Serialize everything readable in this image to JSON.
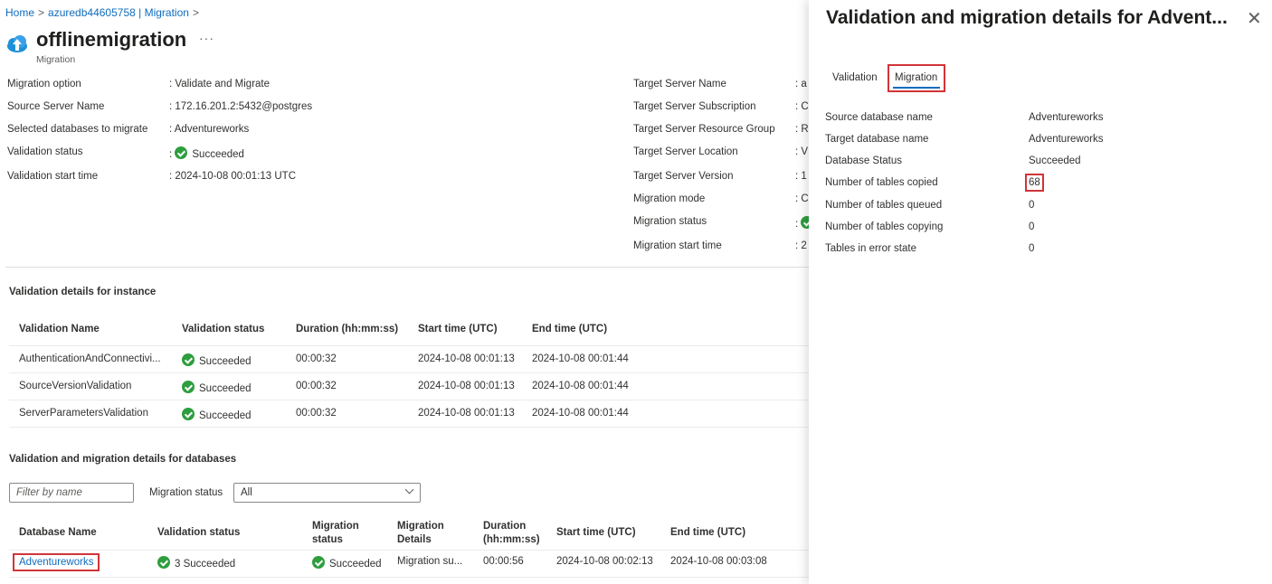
{
  "breadcrumb": {
    "home": "Home",
    "server": "azuredb44605758 | Migration",
    "sep": ">"
  },
  "header": {
    "title": "offlinemigration",
    "more": "···",
    "subtitle": "Migration"
  },
  "summary_left": [
    {
      "label": "Migration option",
      "value": ": Validate and Migrate"
    },
    {
      "label": "Source Server Name",
      "value": ": 172.16.201.2:5432@postgres"
    },
    {
      "label": "Selected databases to migrate",
      "value": ": Adventureworks"
    },
    {
      "label": "Validation status",
      "value": "Succeeded"
    },
    {
      "label": "Validation start time",
      "value": ": 2024-10-08 00:01:13 UTC"
    }
  ],
  "summary_right": [
    {
      "label": "Target Server Name",
      "value": ": a"
    },
    {
      "label": "Target Server Subscription",
      "value": ": C"
    },
    {
      "label": "Target Server Resource Group",
      "value": ": R"
    },
    {
      "label": "Target Server Location",
      "value": ": V"
    },
    {
      "label": "Target Server Version",
      "value": ": 1"
    },
    {
      "label": "Migration mode",
      "value": ": C"
    },
    {
      "label": "Migration status",
      "value": ":"
    },
    {
      "label": "Migration start time",
      "value": ": 2"
    }
  ],
  "instance_validation": {
    "title": "Validation details for instance",
    "headers": [
      "Validation Name",
      "Validation status",
      "Duration (hh:mm:ss)",
      "Start time (UTC)",
      "End time (UTC)"
    ],
    "rows": [
      [
        "AuthenticationAndConnectivi...",
        "Succeeded",
        "00:00:32",
        "2024-10-08 00:01:13",
        "2024-10-08 00:01:44"
      ],
      [
        "SourceVersionValidation",
        "Succeeded",
        "00:00:32",
        "2024-10-08 00:01:13",
        "2024-10-08 00:01:44"
      ],
      [
        "ServerParametersValidation",
        "Succeeded",
        "00:00:32",
        "2024-10-08 00:01:13",
        "2024-10-08 00:01:44"
      ]
    ]
  },
  "databases": {
    "title": "Validation and migration details for databases",
    "filter_placeholder": "Filter by name",
    "status_label": "Migration status",
    "status_value": "All",
    "headers": {
      "db_name": "Database Name",
      "validation_status": "Validation status",
      "migration_status_1": "Migration",
      "migration_status_2": "status",
      "migration_details_1": "Migration",
      "migration_details_2": "Details",
      "duration_1": "Duration",
      "duration_2": "(hh:mm:ss)",
      "start": "Start time (UTC)",
      "end": "End time (UTC)"
    },
    "row": {
      "db_name": "Adventureworks",
      "validation_status": "3 Succeeded",
      "migration_status": "Succeeded",
      "migration_details": "Migration su...",
      "duration": "00:00:56",
      "start": "2024-10-08 00:02:13",
      "end": "2024-10-08 00:03:08"
    }
  },
  "panel": {
    "title": "Validation and migration details for Advent...",
    "close": "✕",
    "tabs": [
      "Validation",
      "Migration"
    ],
    "details": [
      {
        "label": "Source database name",
        "value": "Adventureworks"
      },
      {
        "label": "Target database name",
        "value": "Adventureworks"
      },
      {
        "label": "Database Status",
        "value": "Succeeded"
      },
      {
        "label": "Number of tables copied",
        "value": "68"
      },
      {
        "label": "Number of tables queued",
        "value": "0"
      },
      {
        "label": "Number of tables copying",
        "value": "0"
      },
      {
        "label": "Tables in error state",
        "value": "0"
      }
    ]
  },
  "colors": {
    "accent": "#0f6cbd",
    "success": "#2e9e3e",
    "highlight": "#d13438"
  }
}
